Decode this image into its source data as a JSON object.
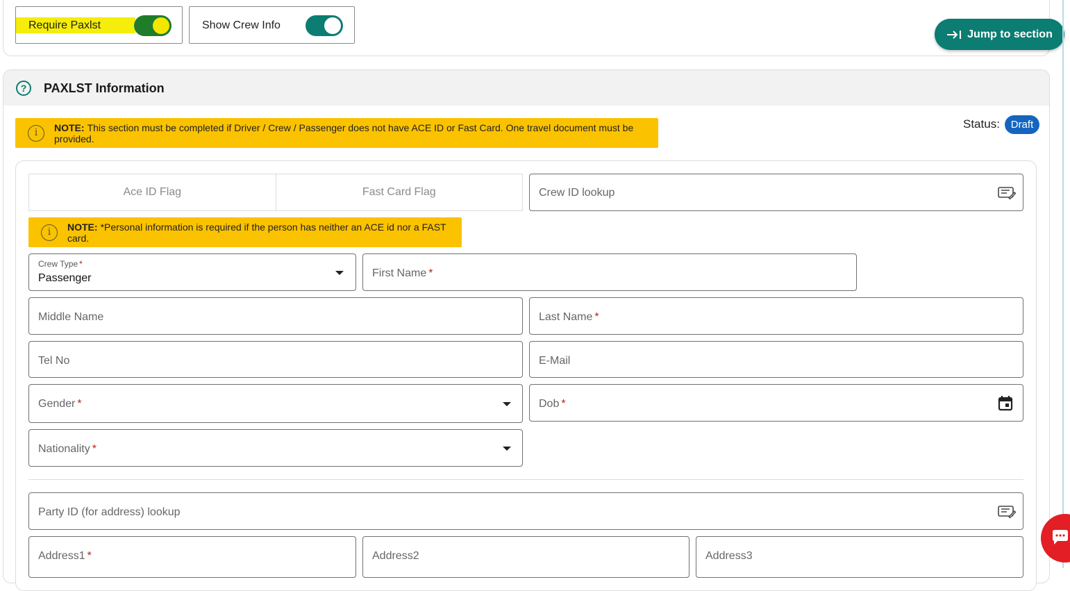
{
  "toggles": {
    "require_paxlst": {
      "label": "Require Paxlst",
      "on": true
    },
    "show_crew_info": {
      "label": "Show Crew Info",
      "on": true
    }
  },
  "jump_button": {
    "label": "Jump to section",
    "icon": "arrow-to-line-icon"
  },
  "section": {
    "title": "PAXLST Information",
    "help_icon": "question-circle-icon",
    "note": {
      "prefix": "NOTE:",
      "text": "This section must be completed if Driver / Crew / Passenger does not have ACE ID or Fast Card. One travel document must be provided."
    },
    "status": {
      "label": "Status:",
      "value": "Draft",
      "color": "#1565c0"
    }
  },
  "flags": {
    "ace": "Ace ID Flag",
    "fast": "Fast Card Flag"
  },
  "crew_lookup": {
    "placeholder": "Crew ID lookup",
    "icon": "lookup-edit-icon"
  },
  "personal_note": {
    "prefix": "NOTE:",
    "text": "*Personal information is required if the person has neither an ACE id nor a FAST card."
  },
  "form": {
    "crew_type": {
      "label": "Crew Type",
      "required": "*",
      "value": "Passenger"
    },
    "first_name": {
      "placeholder": "First Name",
      "required": "*"
    },
    "middle_name": {
      "placeholder": "Middle Name"
    },
    "last_name": {
      "placeholder": "Last Name",
      "required": "*"
    },
    "tel_no": {
      "placeholder": "Tel No"
    },
    "email": {
      "placeholder": "E-Mail"
    },
    "gender": {
      "placeholder": "Gender",
      "required": "*"
    },
    "dob": {
      "placeholder": "Dob",
      "required": "*",
      "icon": "calendar-icon"
    },
    "nationality": {
      "placeholder": "Nationality",
      "required": "*"
    },
    "party_lookup": {
      "placeholder": "Party ID (for address) lookup",
      "icon": "lookup-edit-icon"
    },
    "address1": {
      "placeholder": "Address1",
      "required": "*"
    },
    "address2": {
      "placeholder": "Address2"
    },
    "address3": {
      "placeholder": "Address3"
    }
  },
  "colors": {
    "accent": "#0b7d72",
    "note": "#fbc200",
    "chat": "#e31e24"
  }
}
